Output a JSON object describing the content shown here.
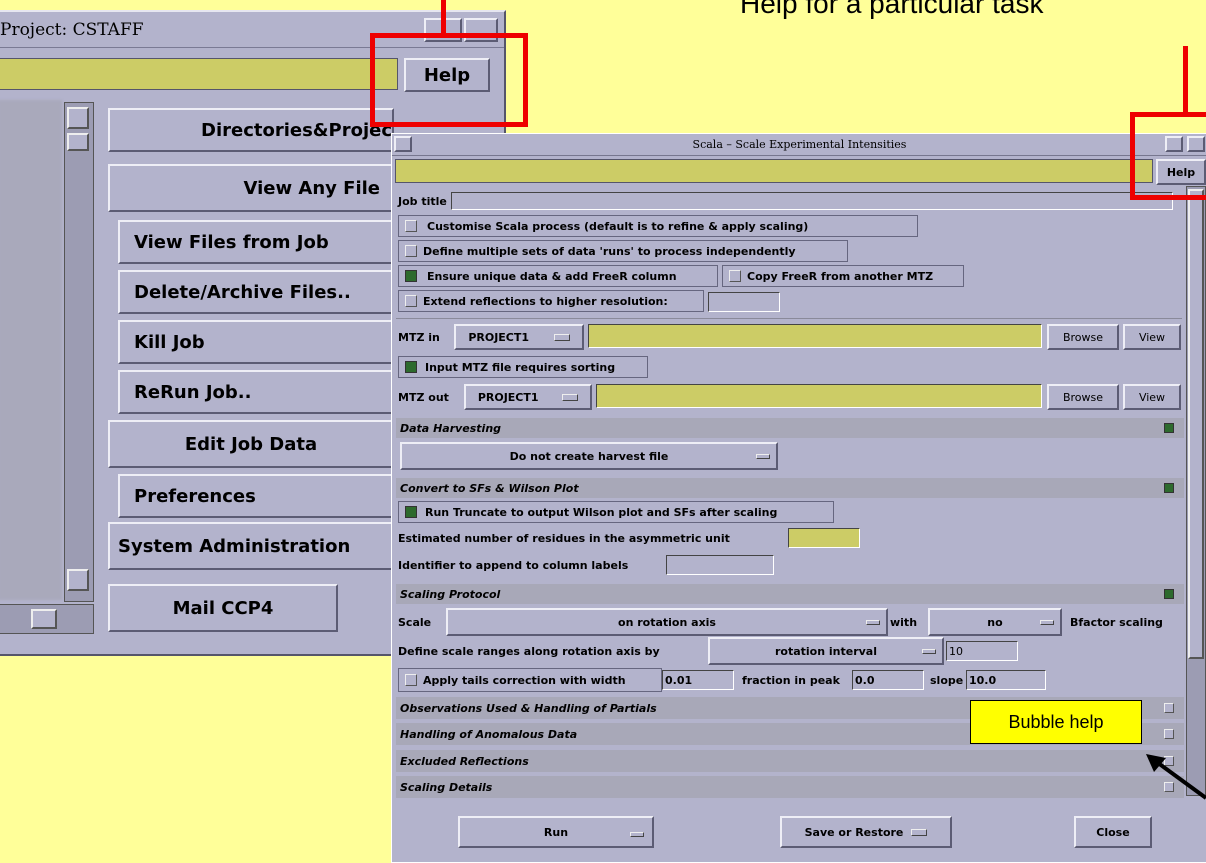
{
  "annotations": {
    "task_help_label": "Help for a particular task",
    "bubble_help_label": "Bubble help",
    "colors": {
      "highlight": "#ee0000",
      "bubble": "#ffff00",
      "background": "#ffff99"
    }
  },
  "main_window": {
    "title": "Project: CSTAFF",
    "help_label": "Help",
    "menu_buttons": [
      "Directories&Projec",
      "View Any File",
      "View Files from Job",
      "Delete/Archive Files..",
      "Kill Job",
      "ReRun Job..",
      "Edit Job Data",
      "Preferences",
      "System Administration",
      "Mail CCP4"
    ]
  },
  "task_window": {
    "title": "Scala – Scale Experimental Intensities",
    "help_label": "Help",
    "job_title_label": "Job title",
    "options": {
      "customise": "Customise Scala process (default is to refine & apply scaling)",
      "multiple_runs": "Define multiple sets of data 'runs' to process independently",
      "unique_data": "Ensure unique data & add FreeR column",
      "copy_freer": "Copy FreeR from another MTZ",
      "extend": "Extend reflections to higher resolution:"
    },
    "mtz_in": {
      "label": "MTZ in",
      "project": "PROJECT1",
      "browse": "Browse",
      "view": "View"
    },
    "sort_label": "Input MTZ file requires sorting",
    "mtz_out": {
      "label": "MTZ out",
      "project": "PROJECT1",
      "browse": "Browse",
      "view": "View"
    },
    "data_harvesting": {
      "header": "Data Harvesting",
      "option": "Do not create harvest file"
    },
    "convert": {
      "header": "Convert to SFs & Wilson Plot",
      "truncate": "Run Truncate to output Wilson plot and SFs after scaling",
      "residues": "Estimated number of residues in the asymmetric unit",
      "identifier": "Identifier to append to column labels"
    },
    "scaling": {
      "header": "Scaling Protocol",
      "scale_label": "Scale",
      "scale_value": "on rotation axis",
      "with_label": "with",
      "bfactor_value": "no",
      "bfactor_label": "Bfactor scaling",
      "ranges_label": "Define scale ranges along rotation axis by",
      "ranges_value": "rotation interval",
      "interval": "10",
      "tails_label": "Apply tails correction with width",
      "width": "0.01",
      "fraction_label": "fraction in peak",
      "fraction": "0.0",
      "slope_label": "slope",
      "slope": "10.0"
    },
    "collapsed_sections": [
      "Observations Used & Handling of Partials",
      "Handling of Anomalous Data",
      "Excluded Reflections",
      "Scaling Details"
    ],
    "footer": {
      "run": "Run",
      "save_restore": "Save or Restore",
      "close": "Close"
    }
  }
}
